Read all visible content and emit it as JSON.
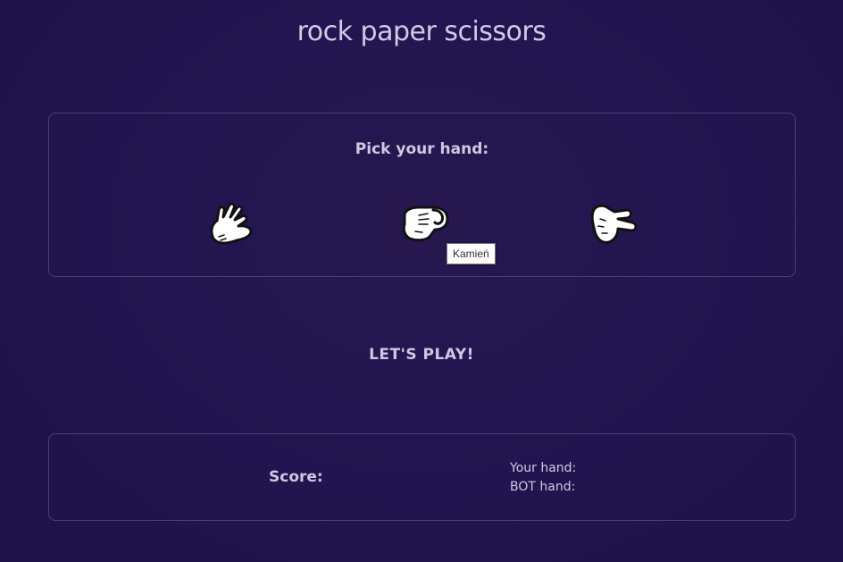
{
  "header": {
    "title": "rock paper scissors"
  },
  "pick": {
    "heading": "Pick your hand:",
    "hands": [
      {
        "name": "paper",
        "icon": "open-hand-icon"
      },
      {
        "name": "rock",
        "icon": "fist-icon"
      },
      {
        "name": "scissors",
        "icon": "two-finger-hand-icon"
      }
    ],
    "tooltip": "Kamień"
  },
  "play": {
    "label": "LET'S PLAY!"
  },
  "score": {
    "label": "Score:",
    "your_hand_label": "Your hand:",
    "bot_hand_label": "BOT hand:"
  },
  "colors": {
    "background": "#221551",
    "text": "#d0c8e0",
    "border": "#4a4070"
  }
}
